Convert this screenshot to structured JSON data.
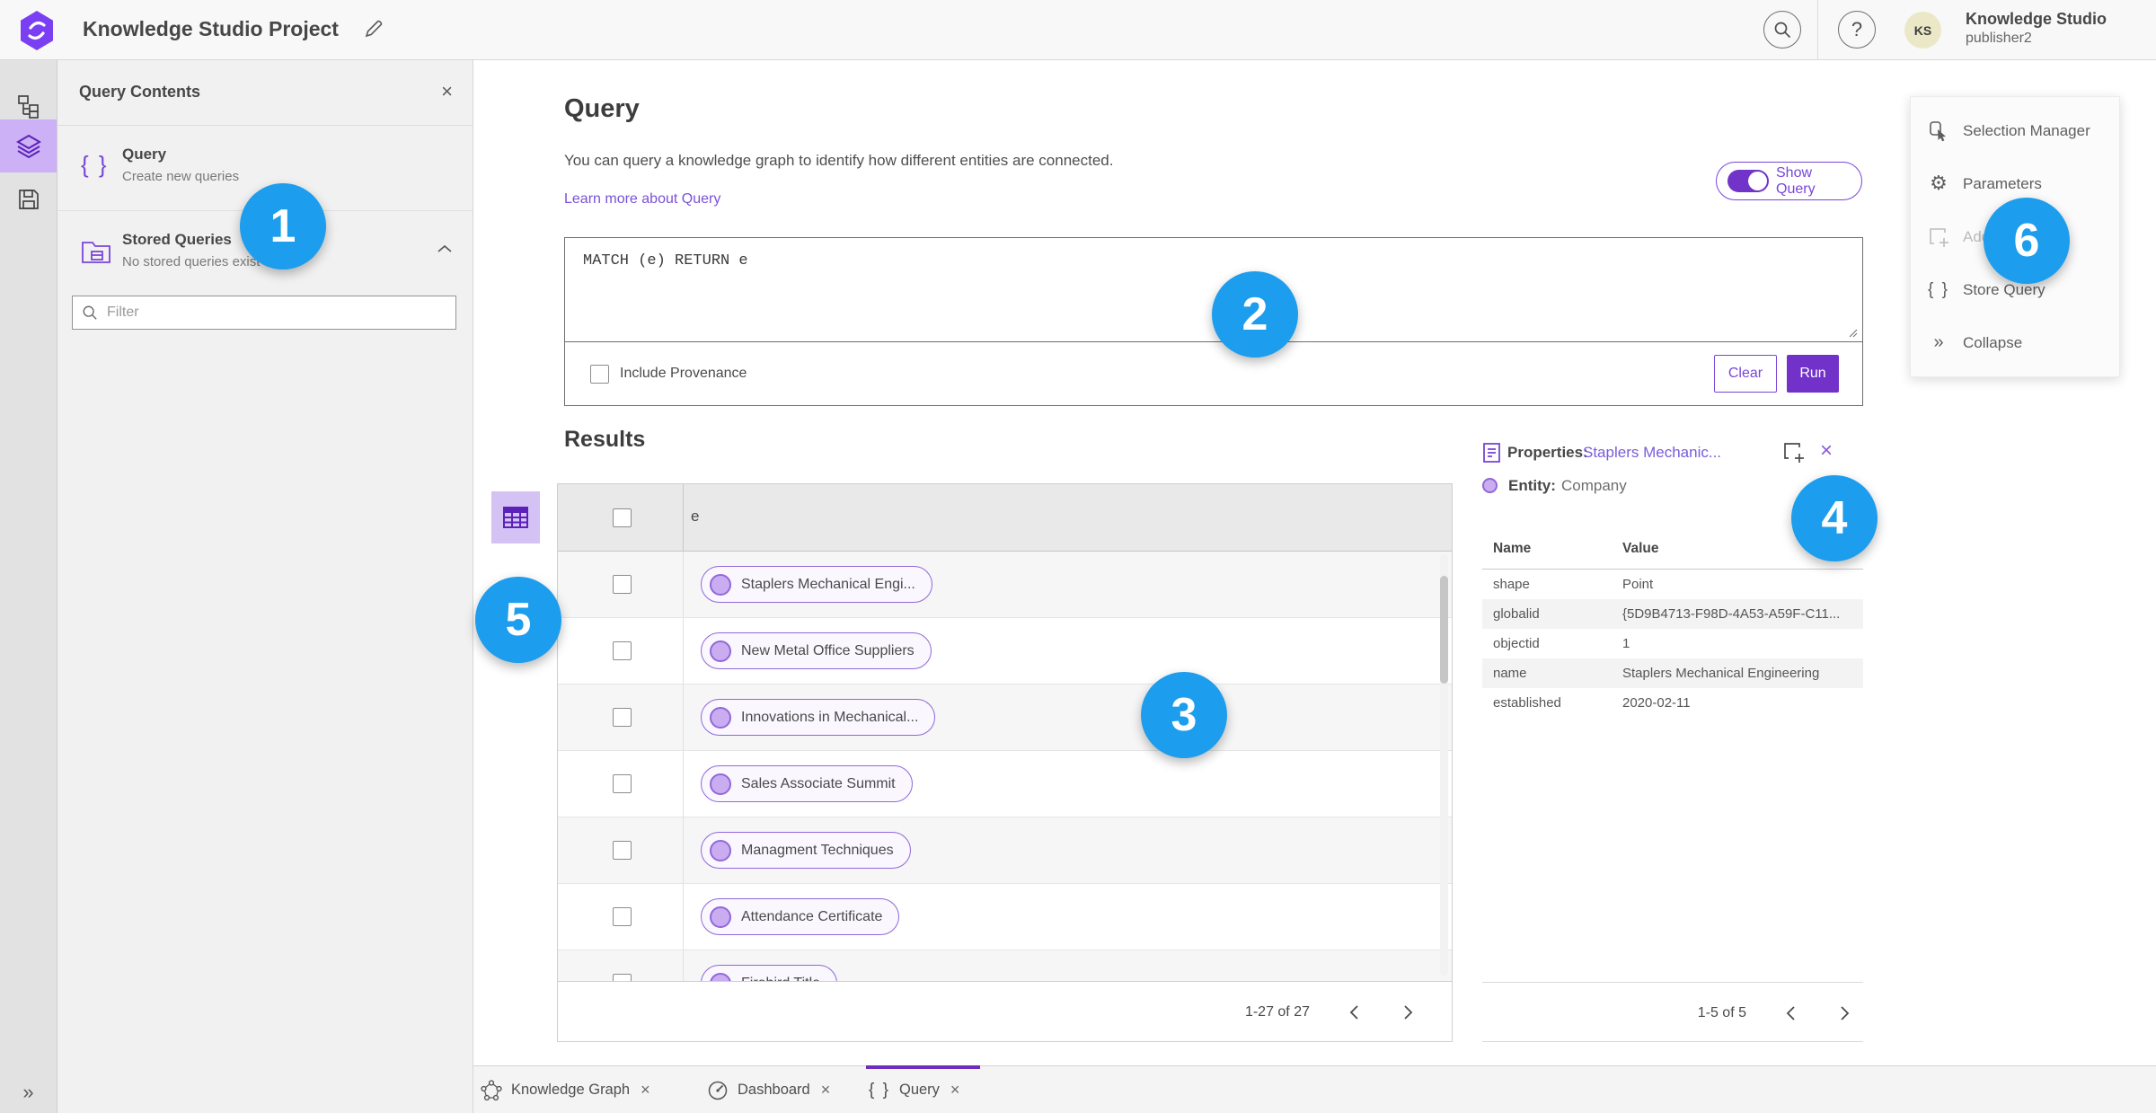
{
  "colors": {
    "accent": "#7a45d9",
    "accent_dark": "#7231c9",
    "badge_blue": "#1d9ded",
    "chip_border": "#9168d9",
    "chip_fill": "#c9adf0",
    "selected_rail": "#ccb1f6"
  },
  "topbar": {
    "title": "Knowledge Studio Project",
    "user_name": "Knowledge Studio",
    "user_role": "publisher2",
    "avatar_initials": "KS",
    "help_glyph": "?"
  },
  "left_panel": {
    "header": "Query Contents",
    "close_glyph": "×",
    "query_item": {
      "title": "Query",
      "subtitle": "Create new queries",
      "icon_glyph": "{ }"
    },
    "stored_item": {
      "title": "Stored Queries",
      "subtitle": "No stored queries exist"
    },
    "filter_placeholder": "Filter"
  },
  "query_section": {
    "heading": "Query",
    "description": "You can query a knowledge graph to identify how different entities are connected.",
    "learn_more": "Learn more about Query",
    "show_query_label": "Show Query",
    "query_text": "MATCH (e) RETURN e",
    "include_provenance_label": "Include Provenance",
    "clear_label": "Clear",
    "run_label": "Run"
  },
  "results": {
    "heading": "Results",
    "column_header": "e",
    "rows": [
      {
        "label": "Staplers Mechanical Engi..."
      },
      {
        "label": "New Metal Office Suppliers"
      },
      {
        "label": "Innovations in Mechanical..."
      },
      {
        "label": "Sales Associate Summit"
      },
      {
        "label": "Managment Techniques"
      },
      {
        "label": "Attendance Certificate"
      },
      {
        "label": "Firebird Title"
      }
    ],
    "pagination": "1-27 of 27"
  },
  "properties": {
    "title_label": "Properties:",
    "title_link": "Staplers Mechanic...",
    "close_glyph": "×",
    "entity_label": "Entity:",
    "entity_value": "Company",
    "col_name": "Name",
    "col_value": "Value",
    "rows": [
      {
        "name": "shape",
        "value": "Point"
      },
      {
        "name": "globalid",
        "value": "{5D9B4713-F98D-4A53-A59F-C11..."
      },
      {
        "name": "objectid",
        "value": "1"
      },
      {
        "name": "name",
        "value": "Staplers Mechanical Engineering"
      },
      {
        "name": "established",
        "value": "2020-02-11"
      }
    ],
    "pagination": "1-5 of 5"
  },
  "right_menu": {
    "items": [
      {
        "label": "Selection Manager"
      },
      {
        "label": "Parameters"
      },
      {
        "label": "Add To Map"
      },
      {
        "label": "Store Query"
      },
      {
        "label": "Collapse"
      }
    ],
    "store_query_glyph": "{ }",
    "collapse_glyph": "»",
    "gear_glyph": "⚙"
  },
  "bottom_tabs": [
    {
      "label": "Knowledge Graph",
      "close_glyph": "×"
    },
    {
      "label": "Dashboard",
      "close_glyph": "×"
    },
    {
      "label": "Query",
      "close_glyph": "×"
    }
  ],
  "rail": {
    "expand_glyph": "»"
  },
  "badges": [
    "1",
    "2",
    "3",
    "4",
    "5",
    "6"
  ]
}
